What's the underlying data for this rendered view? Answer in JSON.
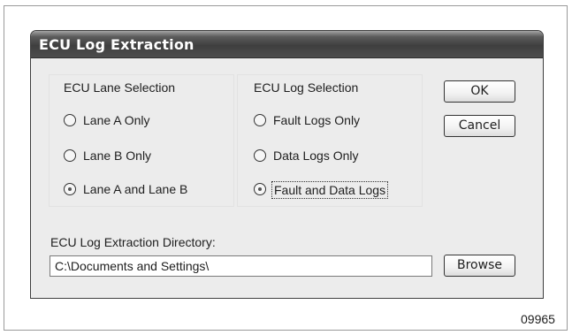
{
  "window": {
    "title": "ECU Log Extraction"
  },
  "lane_group": {
    "title": "ECU Lane Selection",
    "options": [
      {
        "label": "Lane A Only",
        "selected": false
      },
      {
        "label": "Lane B Only",
        "selected": false
      },
      {
        "label": "Lane A and Lane B",
        "selected": true
      }
    ]
  },
  "log_group": {
    "title": "ECU Log Selection",
    "options": [
      {
        "label": "Fault Logs Only",
        "selected": false
      },
      {
        "label": "Data Logs Only",
        "selected": false
      },
      {
        "label": "Fault and Data Logs",
        "selected": true
      }
    ]
  },
  "buttons": {
    "ok": "OK",
    "cancel": "Cancel",
    "browse": "Browse"
  },
  "directory": {
    "label": "ECU Log Extraction Directory:",
    "value": "C:\\Documents and Settings\\"
  },
  "figure": {
    "number": "09965"
  }
}
